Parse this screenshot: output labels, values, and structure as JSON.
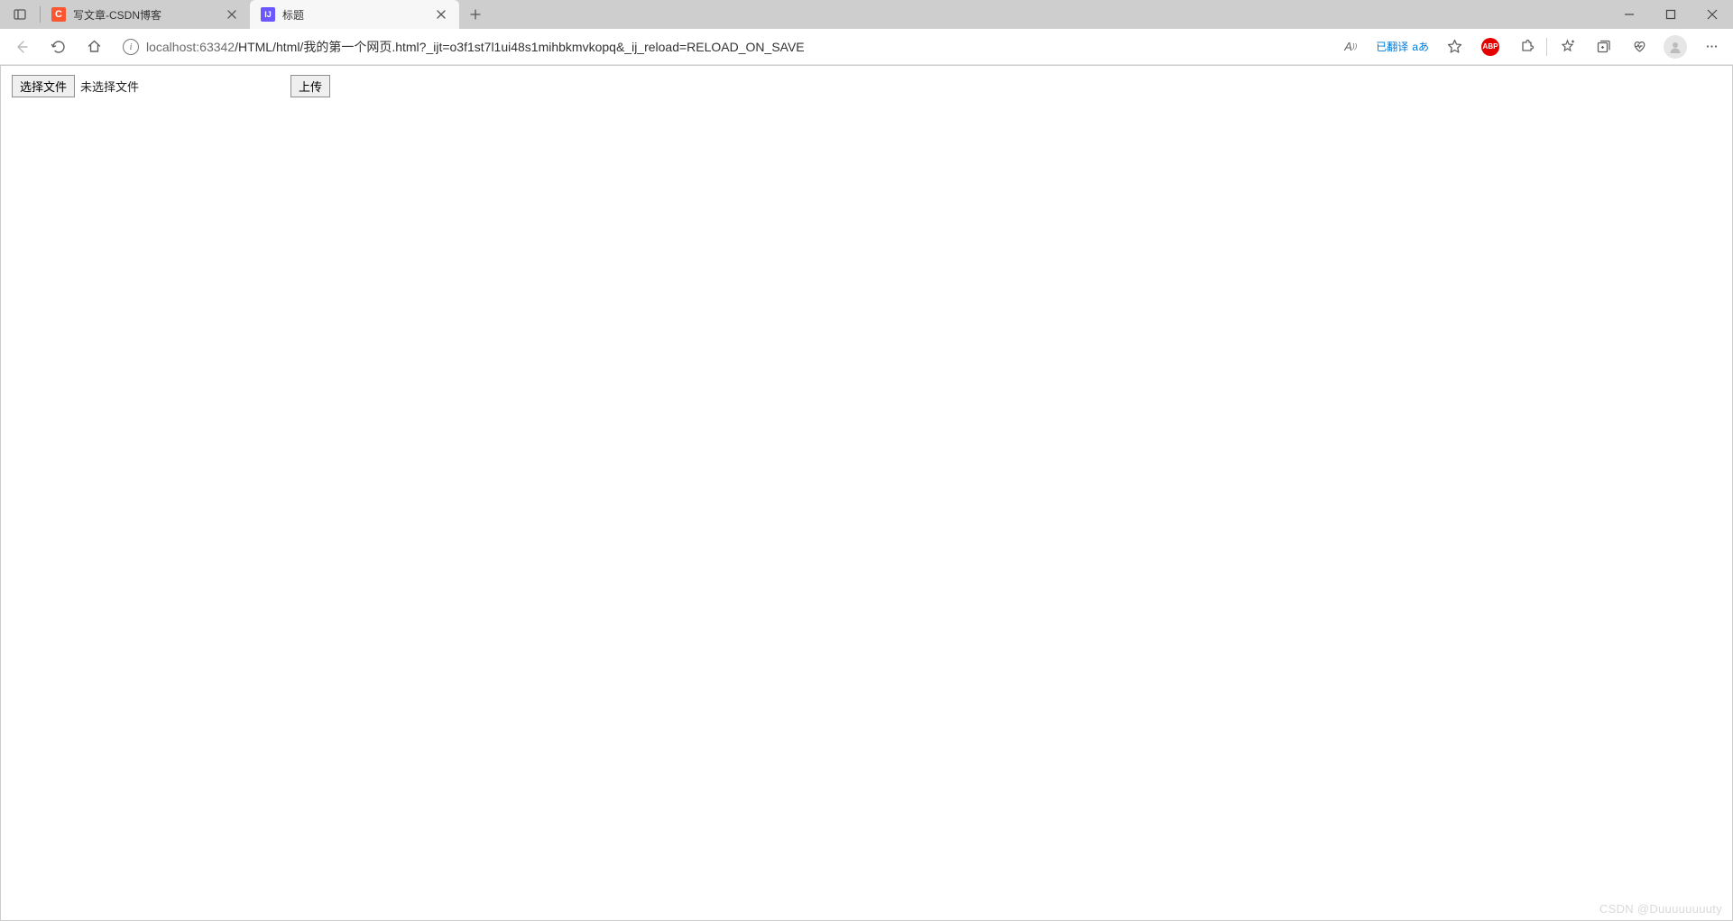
{
  "tabs": [
    {
      "label": "写文章-CSDN博客",
      "active": false,
      "favicon": "csdn",
      "favicon_text": "C"
    },
    {
      "label": "标题",
      "active": true,
      "favicon": "ij",
      "favicon_text": "IJ"
    }
  ],
  "addressbar": {
    "url_host": "localhost",
    "url_port": ":63342",
    "url_path": "/HTML/html/我的第一个网页.html?_ijt=o3f1st7l1ui48s1mihbkmvkopq&_ij_reload=RELOAD_ON_SAVE",
    "read_aloud_label": "A))",
    "translate_label": "已翻译",
    "translate_glyph": "aあ",
    "abp_label": "ABP"
  },
  "page": {
    "choose_file_label": "选择文件",
    "no_file_label": "未选择文件",
    "upload_label": "上传"
  },
  "watermark": "CSDN @Duuuuuuuuty"
}
